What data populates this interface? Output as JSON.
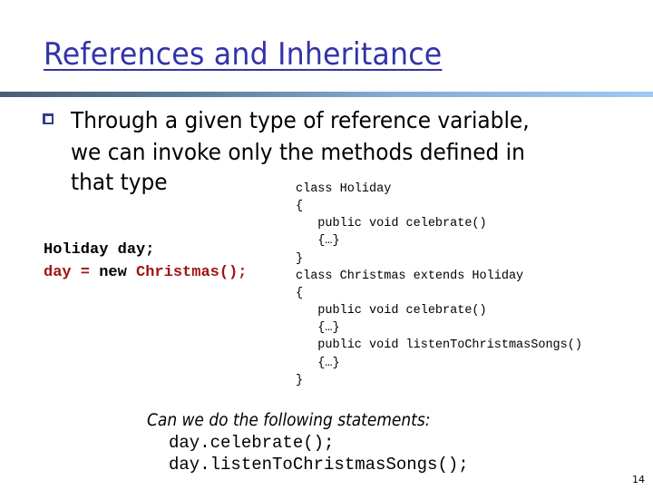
{
  "slide": {
    "title": "References and Inheritance",
    "bullet_icon": "hollow-square-bullet",
    "bullet_lines": [
      "Through a given type of reference variable,",
      "we can invoke only the methods defined in",
      "that type"
    ],
    "left_code": {
      "line1": "Holiday day;",
      "line2_parts": {
        "var": "day =",
        "keyword": " new ",
        "ctor": "Christmas();"
      }
    },
    "right_code": [
      "class Holiday",
      "{",
      "   public void celebrate()",
      "   {…}",
      "}",
      "class Christmas extends Holiday",
      "{",
      "   public void celebrate()",
      "   {…}",
      "   public void listenToChristmasSongs()",
      "   {…}",
      "}"
    ],
    "question": "Can we do the following statements:",
    "statements": [
      "day.celebrate();",
      "day.listenToChristmasSongs();"
    ],
    "page_number": "14",
    "colors": {
      "title": "#3333a8",
      "highlight_code": "#a01414",
      "bullet": "#3a3a8c"
    }
  }
}
